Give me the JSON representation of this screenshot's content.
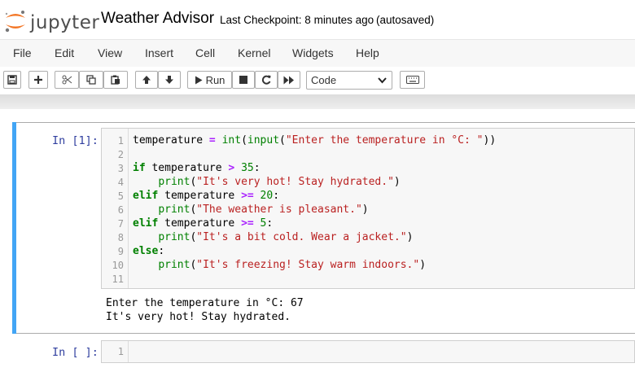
{
  "header": {
    "logo_text": "jupyter",
    "notebook_title": "Weather Advisor",
    "checkpoint": "Last Checkpoint: 8 minutes ago",
    "autosaved": "(autosaved)"
  },
  "menu": [
    "File",
    "Edit",
    "View",
    "Insert",
    "Cell",
    "Kernel",
    "Widgets",
    "Help"
  ],
  "toolbar": {
    "run_label": "Run",
    "cell_type": "Code",
    "icons": [
      "save-icon",
      "plus-icon",
      "cut-icon",
      "copy-icon",
      "paste-icon",
      "arrow-up-icon",
      "arrow-down-icon",
      "play-icon",
      "stop-icon",
      "restart-icon",
      "fast-forward-icon",
      "keyboard-icon"
    ]
  },
  "cells": [
    {
      "prompt": "In [1]:",
      "line_numbers": [
        "1",
        "2",
        "3",
        "4",
        "5",
        "6",
        "7",
        "8",
        "9",
        "10",
        "11"
      ],
      "output": [
        "Enter the temperature in °C: 67",
        "It's very hot! Stay hydrated."
      ]
    },
    {
      "prompt": "In [ ]:",
      "line_numbers": [
        "1"
      ]
    }
  ],
  "colors": {
    "selected_cell_bar": "#42a5f5",
    "prompt": "#303f9f",
    "keyword": "#008000",
    "string": "#ba2121",
    "operator": "#aa22ff",
    "logo_orange": "#f37626"
  }
}
